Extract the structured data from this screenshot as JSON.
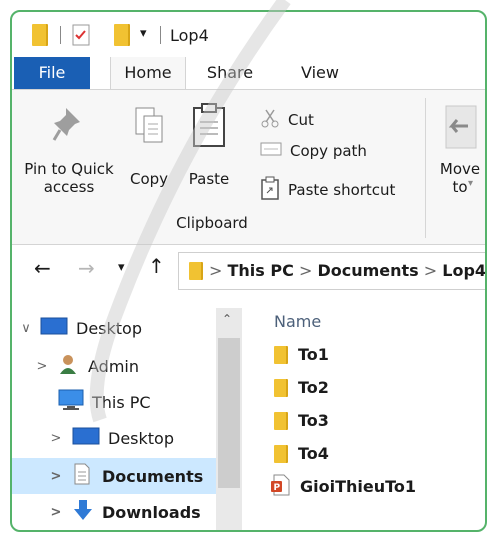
{
  "window": {
    "title": "Lop4"
  },
  "ribbon": {
    "tabs": [
      "File",
      "Home",
      "Share",
      "View"
    ],
    "clipboard": {
      "pin_label": "Pin to Quick access",
      "copy_label": "Copy",
      "paste_label": "Paste",
      "cut_label": "Cut",
      "copy_path_label": "Copy path",
      "paste_shortcut_label": "Paste shortcut",
      "group_label": "Clipboard"
    },
    "organize": {
      "move_to_label": "Move to"
    }
  },
  "address": {
    "crumbs": [
      "This PC",
      "Documents",
      "Lop4"
    ]
  },
  "nav": {
    "items": [
      {
        "label": "Desktop",
        "icon": "desktop-icon"
      },
      {
        "label": "Admin",
        "icon": "user-icon"
      },
      {
        "label": "This PC",
        "icon": "pc-icon"
      },
      {
        "label": "Desktop",
        "icon": "desktop-icon"
      },
      {
        "label": "Documents",
        "icon": "document-icon"
      },
      {
        "label": "Downloads",
        "icon": "download-icon"
      }
    ]
  },
  "files": {
    "column_name": "Name",
    "items": [
      {
        "name": "To1",
        "icon": "folder-icon"
      },
      {
        "name": "To2",
        "icon": "folder-icon"
      },
      {
        "name": "To3",
        "icon": "folder-icon"
      },
      {
        "name": "To4",
        "icon": "folder-icon"
      },
      {
        "name": "GioiThieuTo1",
        "icon": "powerpoint-file-icon"
      }
    ]
  },
  "colors": {
    "accent": "#1a5fb4",
    "frame": "#55b36a",
    "folder": "#f1c232",
    "selected": "#cce8ff"
  }
}
